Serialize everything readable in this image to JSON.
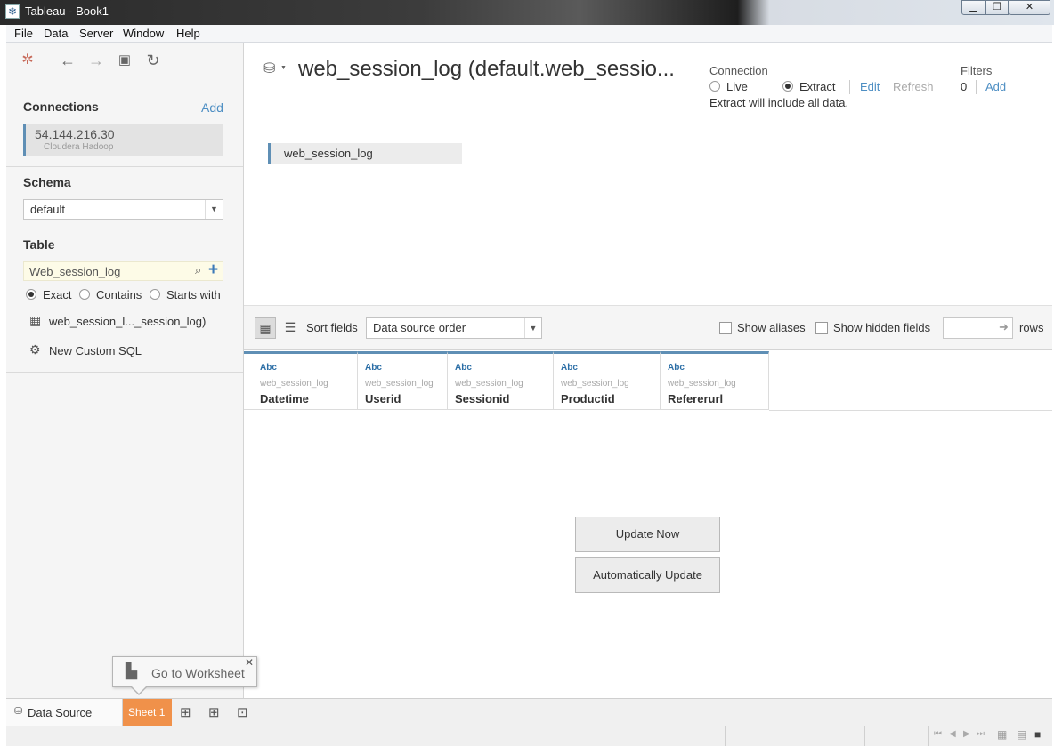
{
  "window": {
    "title": "Tableau - Book1",
    "app_icon": "tableau-logo-icon"
  },
  "menu": [
    "File",
    "Data",
    "Server",
    "Window",
    "Help"
  ],
  "connections": {
    "title": "Connections",
    "add_label": "Add",
    "items": [
      {
        "host": "54.144.216.30",
        "type": "Cloudera Hadoop"
      }
    ]
  },
  "schema": {
    "title": "Schema",
    "value": "default"
  },
  "table": {
    "title": "Table",
    "search_value": "Web_session_log",
    "match_options": [
      "Exact",
      "Contains",
      "Starts with"
    ],
    "selected_option": "Exact",
    "results": [
      "web_session_l..._session_log)",
      "New Custom SQL"
    ]
  },
  "datasource": {
    "title": "web_session_log (default.web_sessio...",
    "connection_label": "Connection",
    "live_label": "Live",
    "extract_label": "Extract",
    "selected_mode": "Extract",
    "edit_label": "Edit",
    "refresh_label": "Refresh",
    "extract_note": "Extract will include all data.",
    "filters_label": "Filters",
    "filters_count": "0",
    "filters_add_label": "Add",
    "canvas_table": "web_session_log"
  },
  "grid_toolbar": {
    "sort_label": "Sort fields",
    "sort_value": "Data source order",
    "show_aliases_label": "Show aliases",
    "show_hidden_label": "Show hidden fields",
    "rows_label": "rows"
  },
  "fields": [
    {
      "type": "Abc",
      "source": "web_session_log",
      "name": "Datetime"
    },
    {
      "type": "Abc",
      "source": "web_session_log",
      "name": "Userid"
    },
    {
      "type": "Abc",
      "source": "web_session_log",
      "name": "Sessionid"
    },
    {
      "type": "Abc",
      "source": "web_session_log",
      "name": "Productid"
    },
    {
      "type": "Abc",
      "source": "web_session_log",
      "name": "Refererurl"
    }
  ],
  "buttons": {
    "update_now": "Update Now",
    "auto_update": "Automatically Update"
  },
  "tooltip": {
    "text": "Go to Worksheet"
  },
  "tabs": {
    "data_source": "Data Source",
    "sheet1": "Sheet 1"
  },
  "colors": {
    "accent_blue": "#4d8ec3",
    "sheet_tab": "#f0914a",
    "field_bar": "#5f8fb5"
  }
}
